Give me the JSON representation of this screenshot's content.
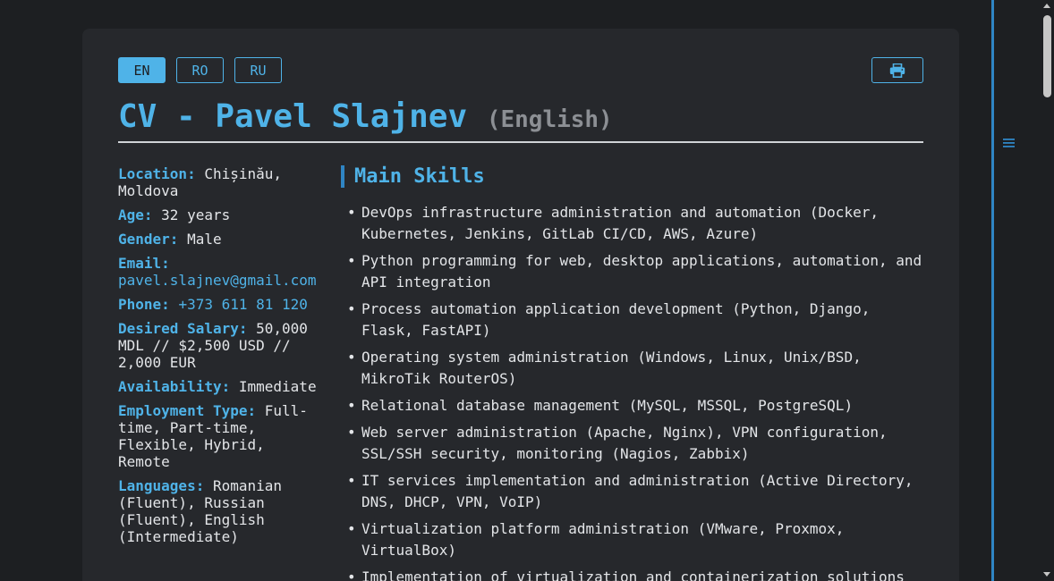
{
  "languages": [
    {
      "label": "EN",
      "active": true
    },
    {
      "label": "RO",
      "active": false
    },
    {
      "label": "RU",
      "active": false
    }
  ],
  "print": {
    "icon": "printer-icon"
  },
  "header": {
    "title": "CV - Pavel Slajnev",
    "subtitle": "(English)"
  },
  "info": {
    "location": {
      "label": "Location:",
      "value": "Chișinău, Moldova"
    },
    "age": {
      "label": "Age:",
      "value": "32 years"
    },
    "gender": {
      "label": "Gender:",
      "value": "Male"
    },
    "email": {
      "label": "Email:",
      "value": "pavel.slajnev@gmail.com"
    },
    "phone": {
      "label": "Phone:",
      "value": "+373 611 81 120"
    },
    "salary": {
      "label": "Desired Salary:",
      "value": "50,000 MDL // $2,500 USD // 2,000 EUR"
    },
    "availability": {
      "label": "Availability:",
      "value": "Immediate"
    },
    "employment": {
      "label": "Employment Type:",
      "value": "Full-time, Part-time, Flexible, Hybrid, Remote"
    },
    "languages": {
      "label": "Languages:",
      "value": "Romanian (Fluent), Russian (Fluent), English (Intermediate)"
    }
  },
  "skills": {
    "heading": "Main Skills",
    "items": [
      "DevOps infrastructure administration and automation (Docker, Kubernetes, Jenkins, GitLab CI/CD, AWS, Azure)",
      "Python programming for web, desktop applications, automation, and API integration",
      "Process automation application development (Python, Django, Flask, FastAPI)",
      "Operating system administration (Windows, Linux, Unix/BSD, MikroTik RouterOS)",
      "Relational database management (MySQL, MSSQL, PostgreSQL)",
      "Web server administration (Apache, Nginx), VPN configuration, SSL/SSH security, monitoring (Nagios, Zabbix)",
      "IT services implementation and administration (Active Directory, DNS, DHCP, VPN, VoIP)",
      "Virtualization platform administration (VMware, Proxmox, VirtualBox)",
      "Implementation of virtualization and containerization solutions"
    ]
  },
  "side_menu": {
    "icon": "menu-icon"
  },
  "colors": {
    "accent": "#4fb3e8",
    "background": "#1d1f22",
    "card": "#26282c",
    "text": "#e3e5e8",
    "muted": "#8c8f94"
  }
}
